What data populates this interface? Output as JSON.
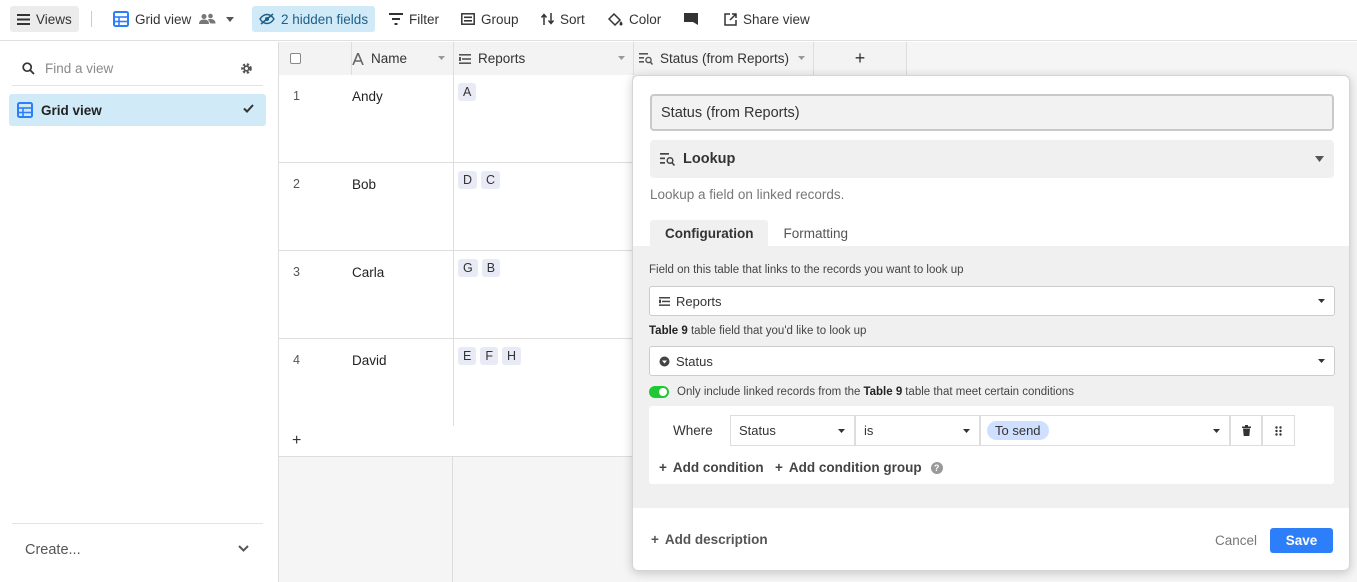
{
  "toolbar": {
    "views_label": "Views",
    "grid_view_label": "Grid view",
    "hidden_fields_label": "2 hidden fields",
    "filter_label": "Filter",
    "group_label": "Group",
    "sort_label": "Sort",
    "color_label": "Color",
    "share_label": "Share view"
  },
  "sidebar": {
    "search_placeholder": "Find a view",
    "items": [
      {
        "label": "Grid view",
        "selected": true
      }
    ],
    "create_label": "Create..."
  },
  "grid": {
    "columns": [
      {
        "label": "Name",
        "icon": "text-a-icon"
      },
      {
        "label": "Reports",
        "icon": "link-icon"
      },
      {
        "label": "Status (from Reports)",
        "icon": "lookup-icon"
      }
    ],
    "add_column_label": "+",
    "add_row_label": "+",
    "rows": [
      {
        "num": "1",
        "name": "Andy",
        "reports": [
          "A"
        ]
      },
      {
        "num": "2",
        "name": "Bob",
        "reports": [
          "D",
          "C"
        ]
      },
      {
        "num": "3",
        "name": "Carla",
        "reports": [
          "G",
          "B"
        ]
      },
      {
        "num": "4",
        "name": "David",
        "reports": [
          "E",
          "F",
          "H"
        ]
      }
    ]
  },
  "modal": {
    "field_name": "Status (from Reports)",
    "field_type": "Lookup",
    "field_type_description": "Lookup a field on linked records.",
    "tabs": [
      "Configuration",
      "Formatting"
    ],
    "link_label": "Field on this table that links to the records you want to look up",
    "link_value": "Reports",
    "lookup_label_table": "Table 9",
    "lookup_label_rest": " table field that you'd like to look up",
    "lookup_value": "Status",
    "toggle_prefix": "Only include linked records from the",
    "toggle_table": "Table 9",
    "toggle_suffix": "table that meet certain conditions",
    "condition": {
      "where": "Where",
      "field": "Status",
      "operator": "is",
      "value": "To send"
    },
    "add_condition": "Add condition",
    "add_condition_group": "Add condition group",
    "add_description": "Add description",
    "cancel": "Cancel",
    "save": "Save"
  },
  "colors": {
    "accent": "#2d7ff9",
    "selected_bg": "#d1eaf7",
    "toggle_on": "#20c933",
    "pill": "#cfdfff"
  }
}
